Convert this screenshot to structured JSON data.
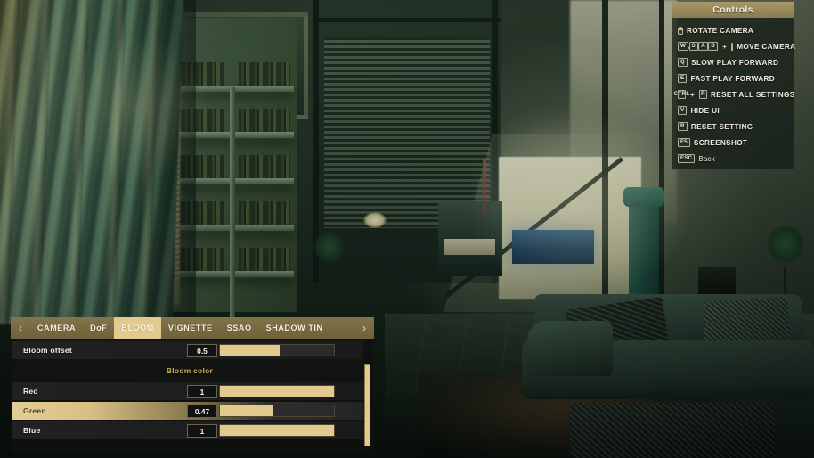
{
  "controls_panel": {
    "title": "Controls",
    "items": [
      {
        "keys": [
          "mouse"
        ],
        "key_type": "mouse",
        "label": "ROTATE CAMERA"
      },
      {
        "keys": [
          "W",
          "S",
          "A",
          "D"
        ],
        "key_type": "wasd-plus-mouse",
        "label": "MOVE CAMERA"
      },
      {
        "keys": [
          "Q"
        ],
        "key_type": "single",
        "label": "SLOW PLAY FORWARD"
      },
      {
        "keys": [
          "E"
        ],
        "key_type": "single",
        "label": "FAST PLAY FORWARD"
      },
      {
        "keys": [
          "CTRL",
          "R"
        ],
        "key_type": "combo",
        "label": "RESET ALL SETTINGS"
      },
      {
        "keys": [
          "V"
        ],
        "key_type": "single",
        "label": "HIDE UI"
      },
      {
        "keys": [
          "R"
        ],
        "key_type": "single",
        "label": "RESET SETTING"
      },
      {
        "keys": [
          "F5"
        ],
        "key_type": "single",
        "label": "SCREENSHOT"
      },
      {
        "keys": [
          "ESC"
        ],
        "key_type": "single",
        "label": "Back"
      }
    ]
  },
  "settings_panel": {
    "prev_arrow": "‹",
    "next_arrow": "›",
    "tabs": [
      {
        "label": "CAMERA",
        "active": false
      },
      {
        "label": "DoF",
        "active": false
      },
      {
        "label": "BLOOM",
        "active": true
      },
      {
        "label": "VIGNETTE",
        "active": false
      },
      {
        "label": "SSAO",
        "active": false
      },
      {
        "label": "SHADOW TIN",
        "active": false
      }
    ],
    "rows": [
      {
        "kind": "slider",
        "label": "Bloom offset",
        "value": "0.5",
        "fill_percent": 52,
        "highlighted": false
      },
      {
        "kind": "header",
        "label": "Bloom color"
      },
      {
        "kind": "slider",
        "label": "Red",
        "value": "1",
        "fill_percent": 100,
        "highlighted": false
      },
      {
        "kind": "slider",
        "label": "Green",
        "value": "0.47",
        "fill_percent": 47,
        "highlighted": true
      },
      {
        "kind": "slider",
        "label": "Blue",
        "value": "1",
        "fill_percent": 100,
        "highlighted": false
      }
    ]
  },
  "colors": {
    "accent_tan": "#e2c98e",
    "tabbar_olive": "#8c7a4e",
    "row_dark": "#222222",
    "section_label_gold": "#d8b055",
    "panel_text": "#f2efe6"
  }
}
